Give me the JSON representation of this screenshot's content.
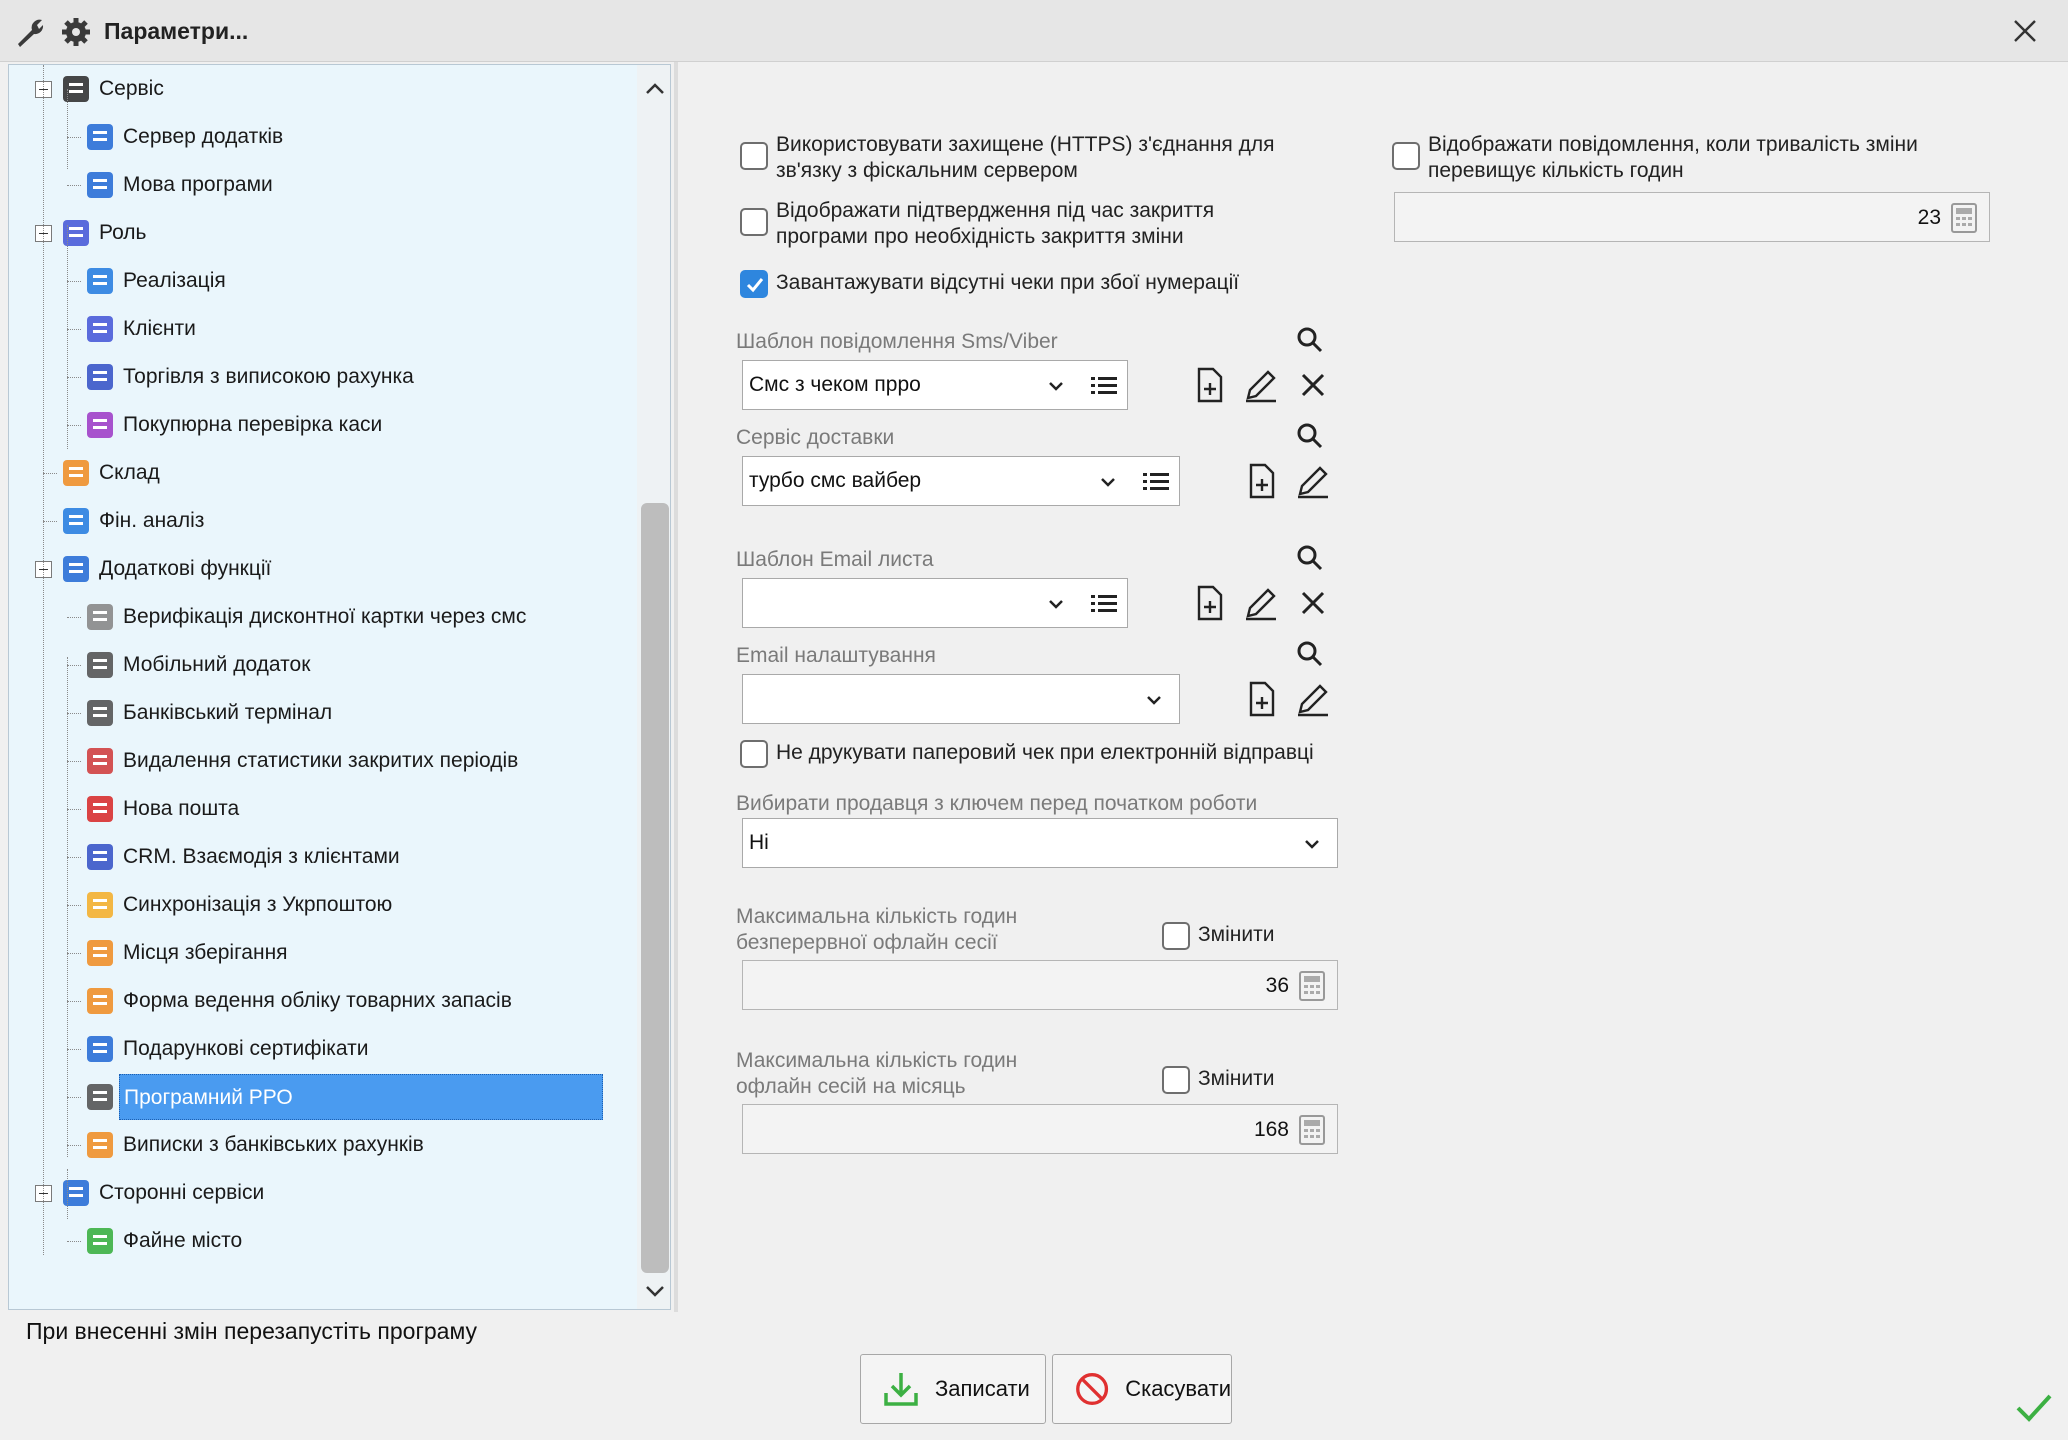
{
  "window": {
    "title": "Параметри...",
    "icons": [
      "wrench-icon",
      "gear-icon"
    ],
    "close_icon": "close-icon"
  },
  "tree": {
    "nodes": [
      {
        "label": "Сервіс",
        "icon": "wrench-icon",
        "level": 1,
        "expanded": true
      },
      {
        "label": "Сервер додатків",
        "icon": "server-icon",
        "level": 2
      },
      {
        "label": "Мова програми",
        "icon": "globe-icon",
        "level": 2
      },
      {
        "label": "Роль",
        "icon": "user-role-icon",
        "level": 1,
        "expanded": true
      },
      {
        "label": "Реалізація",
        "icon": "upload-arrow-icon",
        "level": 2
      },
      {
        "label": "Клієнти",
        "icon": "person-icon",
        "level": 2
      },
      {
        "label": "Торгівля з виписокою рахунка",
        "icon": "invoice-icon",
        "level": 2
      },
      {
        "label": "Покупюрна перевірка каси",
        "icon": "cash-register-icon",
        "level": 2
      },
      {
        "label": "Склад",
        "icon": "layers-icon",
        "level": 1
      },
      {
        "label": "Фін. аналіз",
        "icon": "finance-chart-icon",
        "level": 1
      },
      {
        "label": "Додаткові функції",
        "icon": "puzzle-icon",
        "level": 1,
        "expanded": true
      },
      {
        "label": "Верифікація дисконтної картки через смс",
        "icon": "phone-sms-icon",
        "level": 2
      },
      {
        "label": "Мобільний додаток",
        "icon": "mobile-icon",
        "level": 2
      },
      {
        "label": "Банківський термінал",
        "icon": "terminal-icon",
        "level": 2
      },
      {
        "label": "Видалення статистики закритих періодів",
        "icon": "calendar-delete-icon",
        "level": 2
      },
      {
        "label": "Нова пошта",
        "icon": "nova-poshta-icon",
        "level": 2
      },
      {
        "label": "CRM. Взаємодія з клієнтами",
        "icon": "crm-icon",
        "level": 2
      },
      {
        "label": "Синхронізація з Укрпоштою",
        "icon": "location-pin-icon",
        "level": 2
      },
      {
        "label": "Місця зберігання",
        "icon": "warehouse-icon",
        "level": 2
      },
      {
        "label": "Форма ведення обліку товарних запасів",
        "icon": "list-form-icon",
        "level": 2
      },
      {
        "label": "Подарункові сертифікати",
        "icon": "certificate-icon",
        "level": 2
      },
      {
        "label": "Програмний РРО",
        "icon": "printer-icon",
        "level": 2,
        "selected": true
      },
      {
        "label": "Виписки з банківських рахунків",
        "icon": "bank-card-icon",
        "level": 2
      },
      {
        "label": "Сторонні сервіси",
        "icon": "services-icon",
        "level": 1,
        "expanded": true
      },
      {
        "label": "Файне місто",
        "icon": "map-icon",
        "level": 2
      }
    ]
  },
  "settings": {
    "https": {
      "label_line1": "Використовувати захищене (HTTPS) з'єднання для",
      "label_line2": "зв'язку з фіскальним сервером",
      "checked": false
    },
    "confirm_close": {
      "label_line1": "Відображати підтвердження під час закриття",
      "label_line2": "програми про необхідність закриття зміни",
      "checked": false
    },
    "load_missing": {
      "label": "Завантажувати відсутні чеки при збої нумерації",
      "checked": true
    },
    "shift_duration": {
      "label_line1": "Відображати повідомлення, коли тривалість зміни",
      "label_line2": "перевищує кількість годин",
      "checked": false,
      "value": "23"
    },
    "sms_template": {
      "label": "Шаблон повідомлення Sms/Viber",
      "value": "Смс з чеком прро"
    },
    "delivery": {
      "label": "Сервіс доставки",
      "value": "турбо смс вайбер"
    },
    "email_template": {
      "label": "Шаблон Email листа",
      "value": ""
    },
    "email_settings": {
      "label": "Email налаштування",
      "value": ""
    },
    "no_paper": {
      "label": "Не друкувати паперовий чек при електронній відправці",
      "checked": false
    },
    "seller_key": {
      "label": "Вибирати продавця з ключем перед початком роботи",
      "value": "Ні"
    },
    "max_offline": {
      "label_line1": "Максимальна кількість годин",
      "label_line2": "безперервної офлайн сесії",
      "change_label": "Змінити",
      "checked": false,
      "value": "36"
    },
    "max_monthly": {
      "label_line1": "Максимальна кількість годин",
      "label_line2": "офлайн сесій на місяць",
      "change_label": "Змінити",
      "checked": false,
      "value": "168"
    }
  },
  "footer": {
    "note": "При внесенні змін перезапустіть програму",
    "save_label": "Записати",
    "cancel_label": "Скасувати"
  },
  "colors": {
    "selection": "#4a9bf0",
    "checkbox_checked": "#2e86de",
    "ok_check": "#3cb043"
  }
}
